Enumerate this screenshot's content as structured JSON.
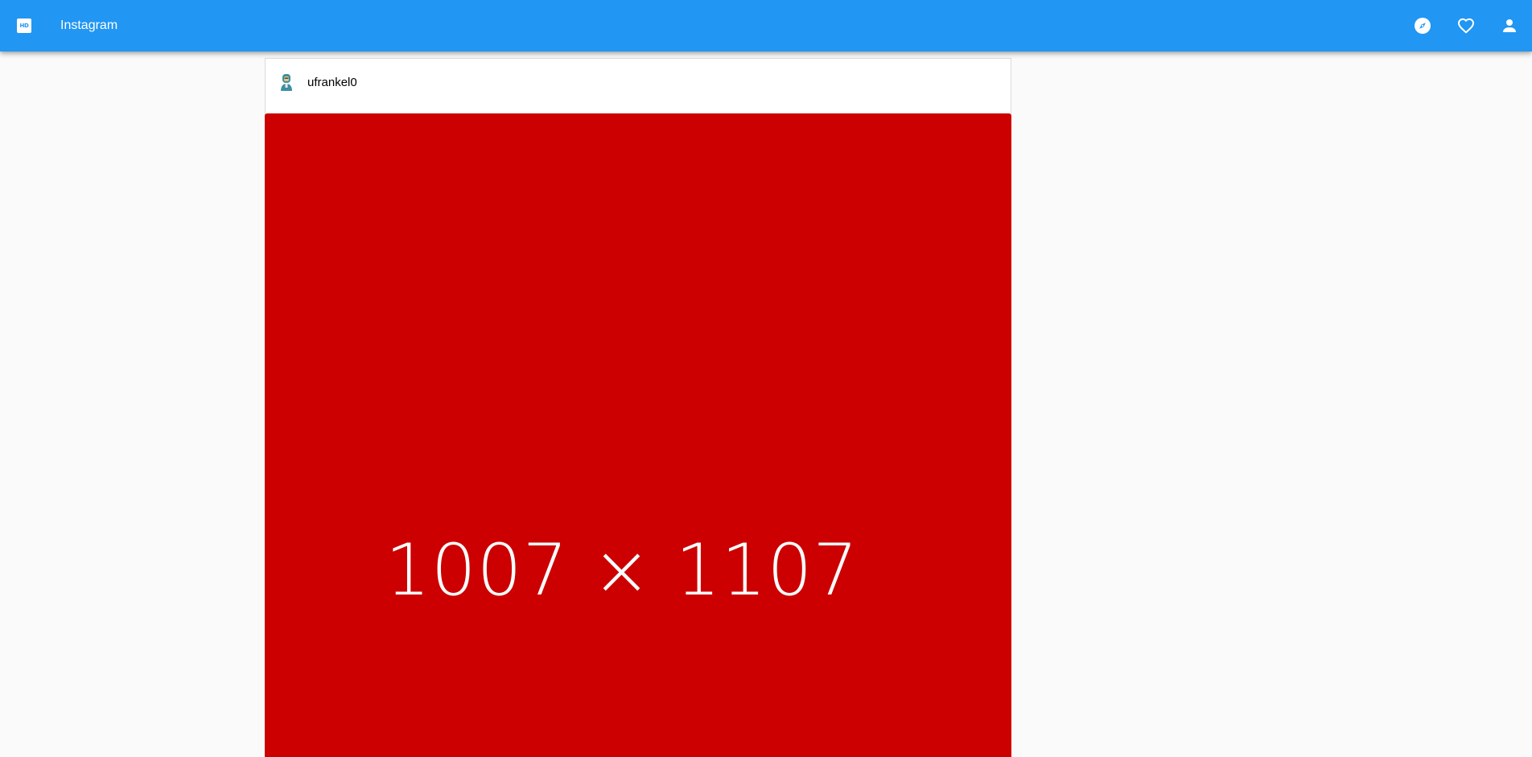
{
  "appbar": {
    "logo_text": "HD",
    "title": "Instagram",
    "color": "#2196f3",
    "icons": [
      "explore-icon",
      "heart-icon",
      "person-icon"
    ]
  },
  "post": {
    "username": "ufrankel0",
    "avatar_icon": "avatar-icon",
    "image": {
      "label": "1007 × 1107",
      "color": "#cc0000"
    }
  }
}
